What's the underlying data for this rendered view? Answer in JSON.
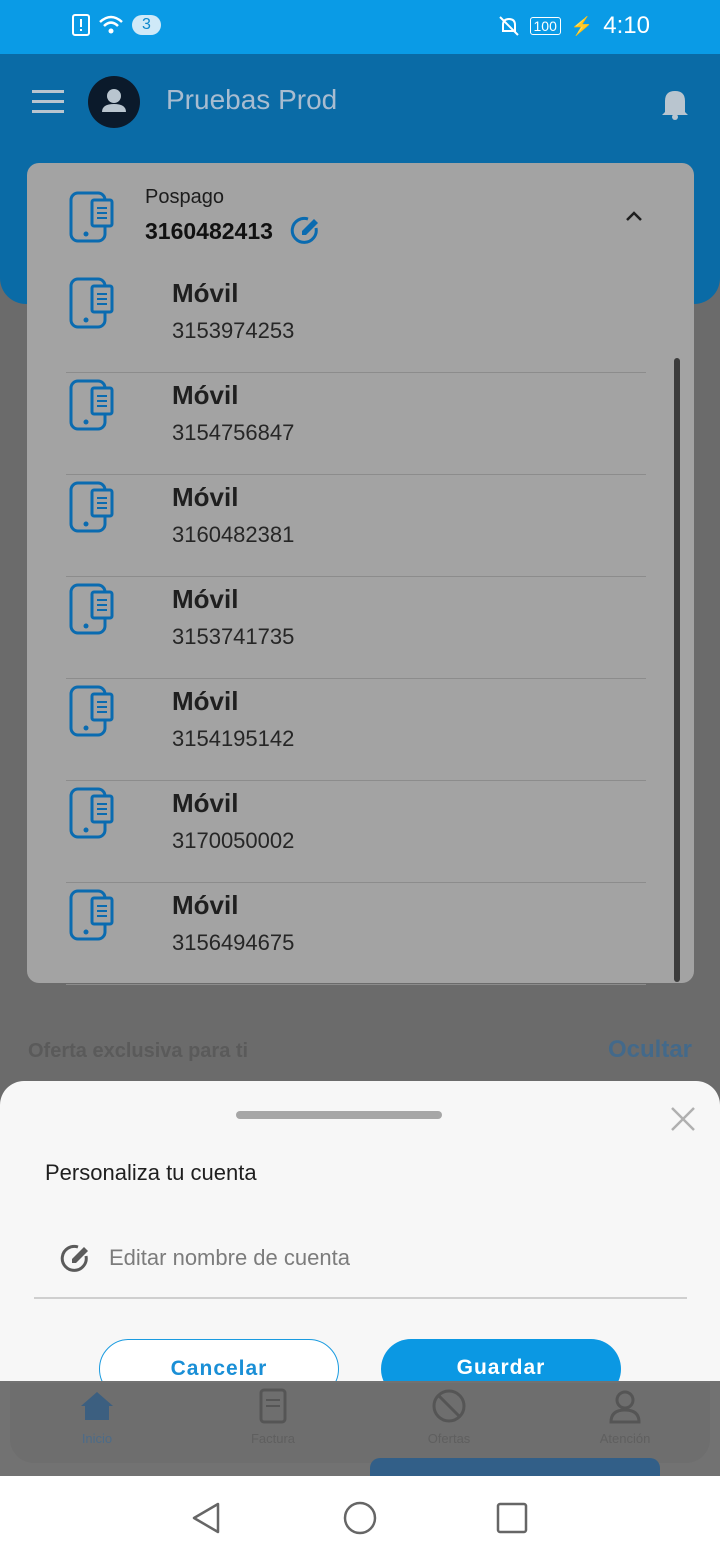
{
  "status_bar": {
    "notif_count": "3",
    "battery": "100",
    "time": "4:10"
  },
  "header": {
    "title": "Pruebas Prod"
  },
  "account": {
    "type": "Pospago",
    "number": "3160482413"
  },
  "lines": [
    {
      "title": "Móvil",
      "number": "3153974253"
    },
    {
      "title": "Móvil",
      "number": "3154756847"
    },
    {
      "title": "Móvil",
      "number": "3160482381"
    },
    {
      "title": "Móvil",
      "number": "3153741735"
    },
    {
      "title": "Móvil",
      "number": "3154195142"
    },
    {
      "title": "Móvil",
      "number": "3170050002"
    },
    {
      "title": "Móvil",
      "number": "3156494675"
    }
  ],
  "background": {
    "offer_title": "Oferta exclusiva para ti",
    "hide_label": "Ocultar"
  },
  "sheet": {
    "title": "Personaliza tu cuenta",
    "field_placeholder": "Editar nombre de cuenta",
    "cancel_label": "Cancelar",
    "save_label": "Guardar"
  },
  "bottom_nav": [
    {
      "label": "Inicio",
      "icon": "home-icon"
    },
    {
      "label": "Factura",
      "icon": "invoice-icon"
    },
    {
      "label": "Ofertas",
      "icon": "offers-icon"
    },
    {
      "label": "Atención",
      "icon": "support-icon"
    }
  ],
  "colors": {
    "primary": "#0B98E3",
    "header": "#0A6BA6",
    "icon_blue": "#0A6BB0"
  }
}
